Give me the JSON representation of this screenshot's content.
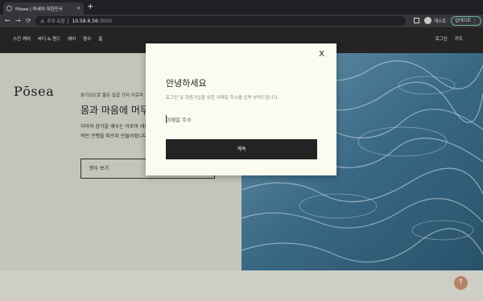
{
  "browser": {
    "tab_title": "Pōsea | 파세아 대한민국",
    "tab_close": "×",
    "new_tab": "+",
    "back": "←",
    "forward": "→",
    "reload": "⟳",
    "insecure_warning": "⚠",
    "insecure_label": "주의 요함",
    "url_host": "10.58.6.56",
    "url_port": ":3000",
    "profile_name": "게스트",
    "update_label": "업데이트 ⋮"
  },
  "header": {
    "menu": [
      {
        "label": "스킨 케어"
      },
      {
        "label": "바디 & 핸드"
      },
      {
        "label": "헤어"
      },
      {
        "label": "향수"
      },
      {
        "label": "홈"
      }
    ],
    "login": "로그인",
    "cart": "카트"
  },
  "hero": {
    "logo": "Pōsea",
    "eyebrow": "호기심으로 물든 일곱 가지 아로마",
    "headline": "몸과 마음에 머무",
    "body": "자아와 감각을 깨우는 아로마 대한 일반적인 관행을 따르지 만들어졌니다.",
    "cta": "향수 보기"
  },
  "scroll_top": "↑",
  "modal": {
    "close": "X",
    "title": "안녕하세요",
    "subtitle": "로그인 및 회원가입을 위한 이메일 주소를 입력 부탁드립니다.",
    "email_placeholder": "이메일 주소",
    "continue": "계속"
  },
  "colors": {
    "header_bg": "#262626",
    "hero_bg": "#cfcfc6",
    "modal_bg": "#fbfbf0",
    "button_bg": "#232323",
    "accent": "#c18b6c"
  }
}
